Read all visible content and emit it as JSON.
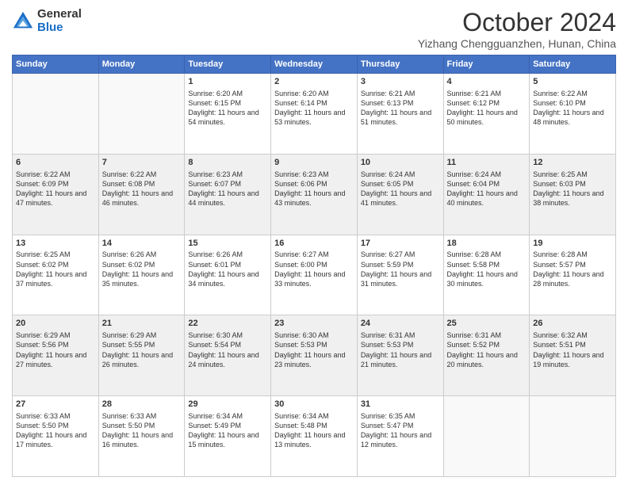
{
  "logo": {
    "general": "General",
    "blue": "Blue"
  },
  "header": {
    "month": "October 2024",
    "location": "Yizhang Chengguanzhen, Hunan, China"
  },
  "columns": [
    "Sunday",
    "Monday",
    "Tuesday",
    "Wednesday",
    "Thursday",
    "Friday",
    "Saturday"
  ],
  "weeks": [
    [
      {
        "day": "",
        "empty": true
      },
      {
        "day": "",
        "empty": true
      },
      {
        "day": "1",
        "sunrise": "Sunrise: 6:20 AM",
        "sunset": "Sunset: 6:15 PM",
        "daylight": "Daylight: 11 hours and 54 minutes."
      },
      {
        "day": "2",
        "sunrise": "Sunrise: 6:20 AM",
        "sunset": "Sunset: 6:14 PM",
        "daylight": "Daylight: 11 hours and 53 minutes."
      },
      {
        "day": "3",
        "sunrise": "Sunrise: 6:21 AM",
        "sunset": "Sunset: 6:13 PM",
        "daylight": "Daylight: 11 hours and 51 minutes."
      },
      {
        "day": "4",
        "sunrise": "Sunrise: 6:21 AM",
        "sunset": "Sunset: 6:12 PM",
        "daylight": "Daylight: 11 hours and 50 minutes."
      },
      {
        "day": "5",
        "sunrise": "Sunrise: 6:22 AM",
        "sunset": "Sunset: 6:10 PM",
        "daylight": "Daylight: 11 hours and 48 minutes."
      }
    ],
    [
      {
        "day": "6",
        "sunrise": "Sunrise: 6:22 AM",
        "sunset": "Sunset: 6:09 PM",
        "daylight": "Daylight: 11 hours and 47 minutes."
      },
      {
        "day": "7",
        "sunrise": "Sunrise: 6:22 AM",
        "sunset": "Sunset: 6:08 PM",
        "daylight": "Daylight: 11 hours and 46 minutes."
      },
      {
        "day": "8",
        "sunrise": "Sunrise: 6:23 AM",
        "sunset": "Sunset: 6:07 PM",
        "daylight": "Daylight: 11 hours and 44 minutes."
      },
      {
        "day": "9",
        "sunrise": "Sunrise: 6:23 AM",
        "sunset": "Sunset: 6:06 PM",
        "daylight": "Daylight: 11 hours and 43 minutes."
      },
      {
        "day": "10",
        "sunrise": "Sunrise: 6:24 AM",
        "sunset": "Sunset: 6:05 PM",
        "daylight": "Daylight: 11 hours and 41 minutes."
      },
      {
        "day": "11",
        "sunrise": "Sunrise: 6:24 AM",
        "sunset": "Sunset: 6:04 PM",
        "daylight": "Daylight: 11 hours and 40 minutes."
      },
      {
        "day": "12",
        "sunrise": "Sunrise: 6:25 AM",
        "sunset": "Sunset: 6:03 PM",
        "daylight": "Daylight: 11 hours and 38 minutes."
      }
    ],
    [
      {
        "day": "13",
        "sunrise": "Sunrise: 6:25 AM",
        "sunset": "Sunset: 6:02 PM",
        "daylight": "Daylight: 11 hours and 37 minutes."
      },
      {
        "day": "14",
        "sunrise": "Sunrise: 6:26 AM",
        "sunset": "Sunset: 6:02 PM",
        "daylight": "Daylight: 11 hours and 35 minutes."
      },
      {
        "day": "15",
        "sunrise": "Sunrise: 6:26 AM",
        "sunset": "Sunset: 6:01 PM",
        "daylight": "Daylight: 11 hours and 34 minutes."
      },
      {
        "day": "16",
        "sunrise": "Sunrise: 6:27 AM",
        "sunset": "Sunset: 6:00 PM",
        "daylight": "Daylight: 11 hours and 33 minutes."
      },
      {
        "day": "17",
        "sunrise": "Sunrise: 6:27 AM",
        "sunset": "Sunset: 5:59 PM",
        "daylight": "Daylight: 11 hours and 31 minutes."
      },
      {
        "day": "18",
        "sunrise": "Sunrise: 6:28 AM",
        "sunset": "Sunset: 5:58 PM",
        "daylight": "Daylight: 11 hours and 30 minutes."
      },
      {
        "day": "19",
        "sunrise": "Sunrise: 6:28 AM",
        "sunset": "Sunset: 5:57 PM",
        "daylight": "Daylight: 11 hours and 28 minutes."
      }
    ],
    [
      {
        "day": "20",
        "sunrise": "Sunrise: 6:29 AM",
        "sunset": "Sunset: 5:56 PM",
        "daylight": "Daylight: 11 hours and 27 minutes."
      },
      {
        "day": "21",
        "sunrise": "Sunrise: 6:29 AM",
        "sunset": "Sunset: 5:55 PM",
        "daylight": "Daylight: 11 hours and 26 minutes."
      },
      {
        "day": "22",
        "sunrise": "Sunrise: 6:30 AM",
        "sunset": "Sunset: 5:54 PM",
        "daylight": "Daylight: 11 hours and 24 minutes."
      },
      {
        "day": "23",
        "sunrise": "Sunrise: 6:30 AM",
        "sunset": "Sunset: 5:53 PM",
        "daylight": "Daylight: 11 hours and 23 minutes."
      },
      {
        "day": "24",
        "sunrise": "Sunrise: 6:31 AM",
        "sunset": "Sunset: 5:53 PM",
        "daylight": "Daylight: 11 hours and 21 minutes."
      },
      {
        "day": "25",
        "sunrise": "Sunrise: 6:31 AM",
        "sunset": "Sunset: 5:52 PM",
        "daylight": "Daylight: 11 hours and 20 minutes."
      },
      {
        "day": "26",
        "sunrise": "Sunrise: 6:32 AM",
        "sunset": "Sunset: 5:51 PM",
        "daylight": "Daylight: 11 hours and 19 minutes."
      }
    ],
    [
      {
        "day": "27",
        "sunrise": "Sunrise: 6:33 AM",
        "sunset": "Sunset: 5:50 PM",
        "daylight": "Daylight: 11 hours and 17 minutes."
      },
      {
        "day": "28",
        "sunrise": "Sunrise: 6:33 AM",
        "sunset": "Sunset: 5:50 PM",
        "daylight": "Daylight: 11 hours and 16 minutes."
      },
      {
        "day": "29",
        "sunrise": "Sunrise: 6:34 AM",
        "sunset": "Sunset: 5:49 PM",
        "daylight": "Daylight: 11 hours and 15 minutes."
      },
      {
        "day": "30",
        "sunrise": "Sunrise: 6:34 AM",
        "sunset": "Sunset: 5:48 PM",
        "daylight": "Daylight: 11 hours and 13 minutes."
      },
      {
        "day": "31",
        "sunrise": "Sunrise: 6:35 AM",
        "sunset": "Sunset: 5:47 PM",
        "daylight": "Daylight: 11 hours and 12 minutes."
      },
      {
        "day": "",
        "empty": true
      },
      {
        "day": "",
        "empty": true
      }
    ]
  ]
}
